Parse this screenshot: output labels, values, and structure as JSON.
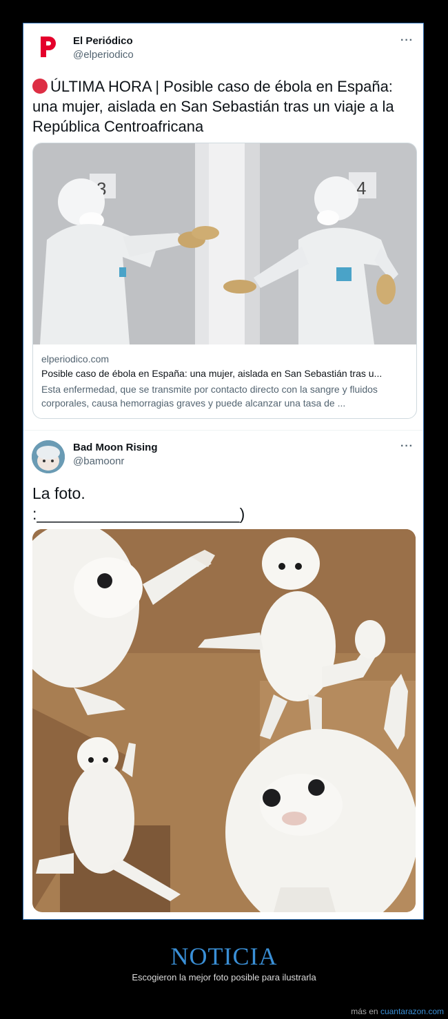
{
  "tweet1": {
    "author_name": "El Periódico",
    "author_handle": "@elperiodico",
    "more": "···",
    "text": "ÚLTIMA HORA | Posible caso de ébola en España: una mujer, aislada en San Sebastián tras un viaje a la República Centroafricana",
    "card": {
      "door_left": "3",
      "door_right": "4",
      "domain": "elperiodico.com",
      "title": "Posible caso de ébola en España: una mujer, aislada en San Sebastián tras u...",
      "description": "Esta enfermedad, que se transmite por contacto directo con la sangre y fluidos corporales, causa hemorragias graves y puede alcanzar una tasa de ..."
    }
  },
  "tweet2": {
    "author_name": "Bad Moon Rising",
    "author_handle": "@bamoonr",
    "more": "···",
    "text_line1": "La foto.",
    "text_line2": ":_______________________)"
  },
  "caption": {
    "title": "NOTICIA",
    "subtitle": "Escogieron la mejor foto posible para ilustrarla"
  },
  "footer": {
    "prefix": "más en",
    "link": "cuantarazon.com"
  },
  "colors": {
    "accent": "#3a8fd6",
    "brand_red": "#e4002b",
    "background": "#000000"
  }
}
